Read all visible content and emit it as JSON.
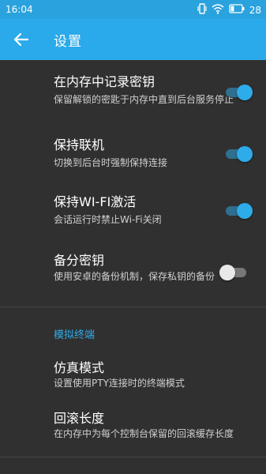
{
  "status_bar": {
    "time": "16:04",
    "battery_level": "28",
    "icons": [
      "vibrate-icon",
      "wifi-icon",
      "battery-icon"
    ]
  },
  "app_bar": {
    "title": "设置",
    "back_icon": "arrow-back-icon",
    "color": "#2aa9eb"
  },
  "settings": [
    {
      "title": "在内存中记录密钥",
      "summary": "保留解锁的密匙于内存中直到后台服务停止",
      "enabled": true
    },
    {
      "title": "保持联机",
      "summary": "切换到后台时强制保持连接",
      "enabled": true
    },
    {
      "title": "保持WI-FI激活",
      "summary": "会话运行时禁止Wi-Fi关闭",
      "enabled": true
    },
    {
      "title": "备分密钥",
      "summary": "使用安卓的备份机制，保存私钥的备份",
      "enabled": false
    }
  ],
  "terminal_section": {
    "label": "模拟终端",
    "items": [
      {
        "title": "仿真模式",
        "summary": "设置使用PTY连接时的终端模式"
      },
      {
        "title": "回滚长度",
        "summary": "在内存中为每个控制台保留的回滚缓存长度"
      }
    ]
  },
  "colors": {
    "accent": "#2eabe9",
    "background": "#303030"
  }
}
